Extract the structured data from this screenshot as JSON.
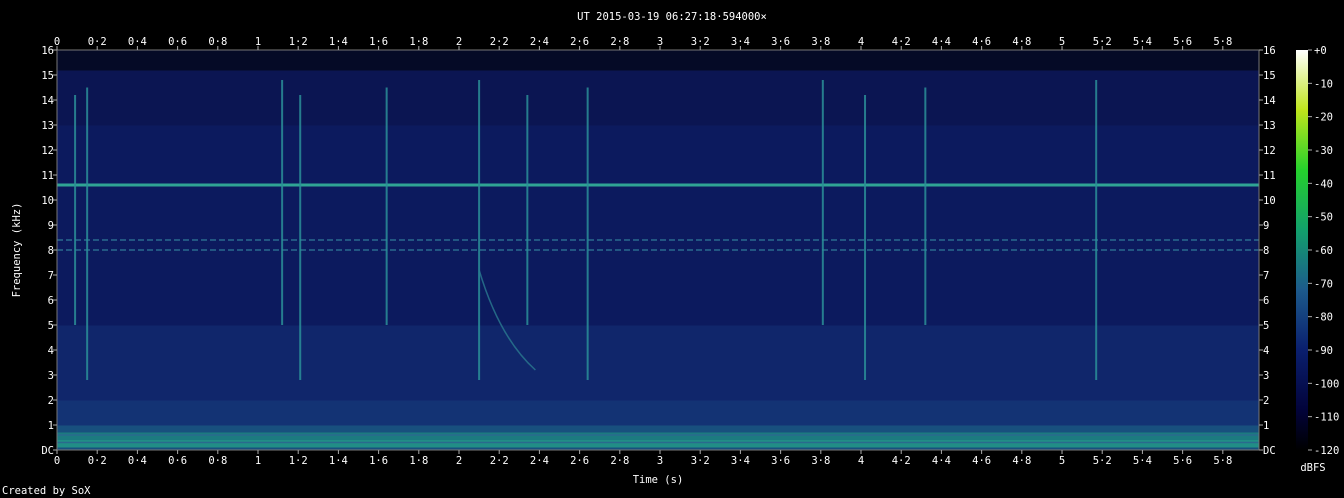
{
  "app": {
    "title": "UT 2015-03-19 06:27:18·594000×",
    "credit": "Created by SoX"
  },
  "chart_data": {
    "type": "heatmap",
    "title": "UT 2015-03-19 06:27:18·594000×",
    "xlabel": "Time (s)",
    "ylabel": "Frequency (kHz)",
    "colorbar_label": "dBFS",
    "xlim": [
      0,
      5.98
    ],
    "ylim": [
      0,
      16
    ],
    "x_ticks": [
      "0",
      "0·2",
      "0·4",
      "0·6",
      "0·8",
      "1",
      "1·2",
      "1·4",
      "1·6",
      "1·8",
      "2",
      "2·2",
      "2·4",
      "2·6",
      "2·8",
      "3",
      "3·2",
      "3·4",
      "3·6",
      "3·8",
      "4",
      "4·2",
      "4·4",
      "4·6",
      "4·8",
      "5",
      "5·2",
      "5·4",
      "5·6",
      "5·8"
    ],
    "y_ticks": [
      "DC",
      "1",
      "2",
      "3",
      "4",
      "5",
      "6",
      "7",
      "8",
      "9",
      "10",
      "11",
      "12",
      "13",
      "14",
      "15",
      "16"
    ],
    "colorbar_ticks": [
      "+0",
      "-10",
      "-20",
      "-30",
      "-40",
      "-50",
      "-60",
      "-70",
      "-80",
      "-90",
      "-100",
      "-110",
      "-120"
    ],
    "colorbar_range_dbfs": [
      -120,
      0
    ],
    "features": {
      "horizontal_tones_khz": [
        0.3,
        0.6,
        10.6,
        8.0,
        8.4
      ],
      "broadband_transients_s": [
        0.09,
        0.15,
        1.12,
        1.21,
        1.64,
        2.1,
        2.34,
        2.64,
        3.81,
        4.02,
        4.32,
        5.17
      ]
    }
  }
}
